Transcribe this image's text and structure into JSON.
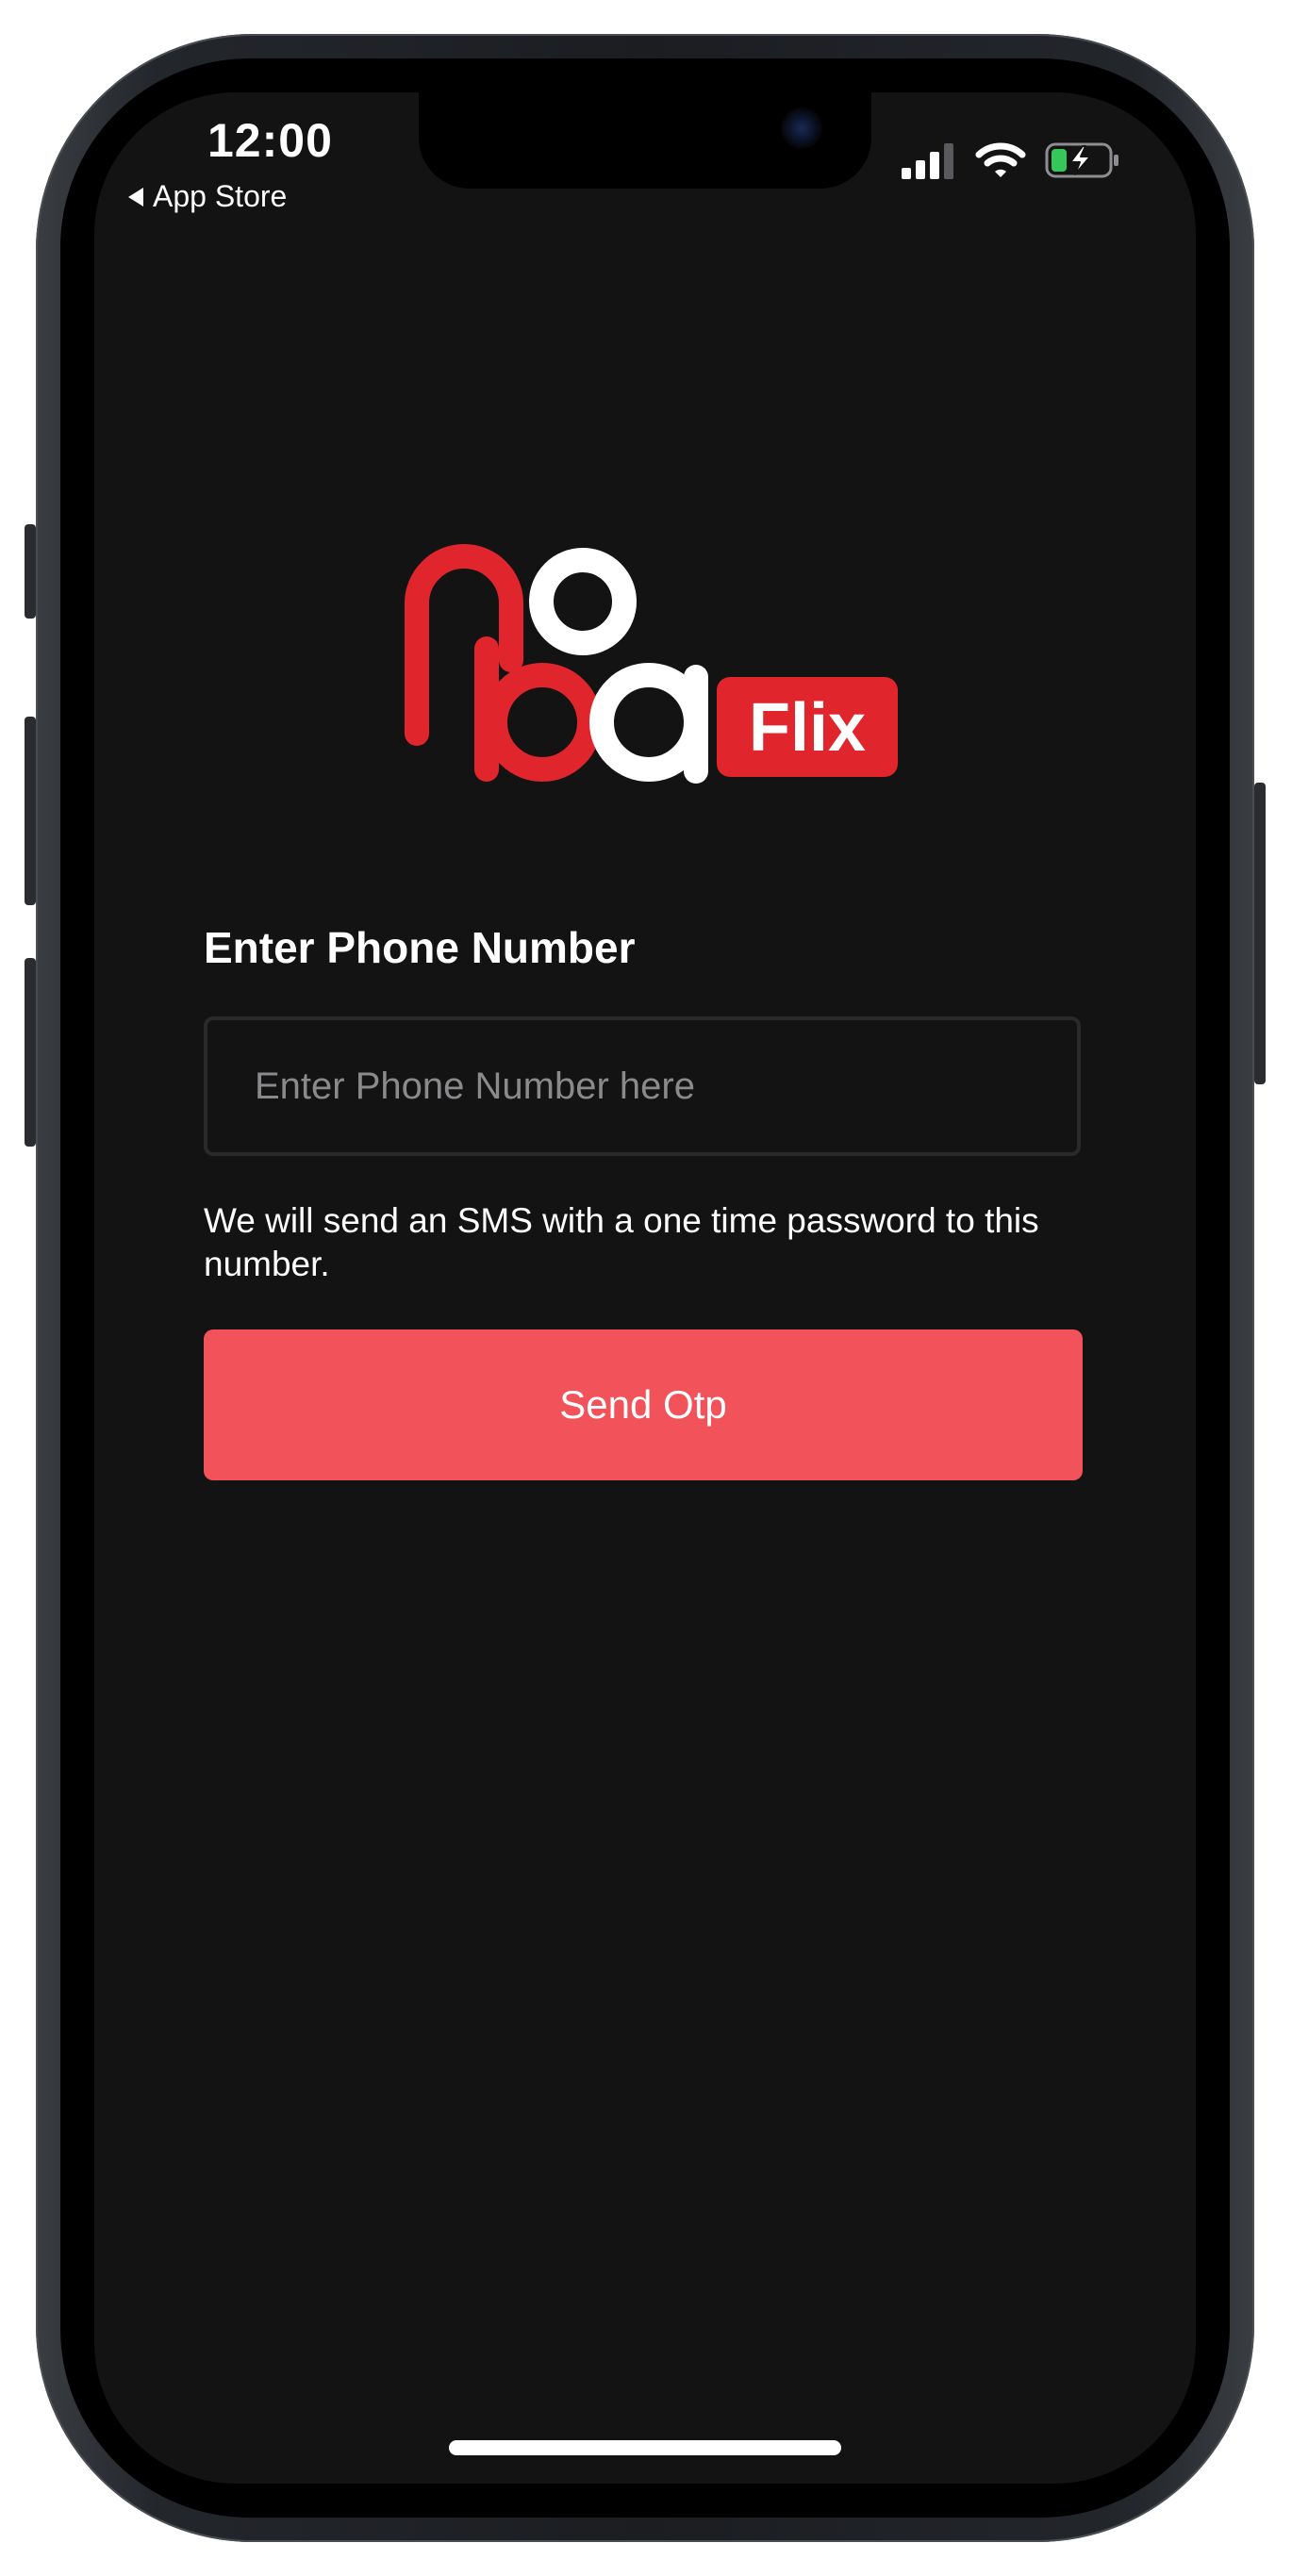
{
  "status_bar": {
    "time": "12:00",
    "back_label": "App Store"
  },
  "logo": {
    "wordmark_letters": [
      "n",
      "o",
      "b",
      "a"
    ],
    "badge_text": "Flix",
    "brand_red": "#e0262c",
    "brand_white": "#ffffff"
  },
  "form": {
    "title": "Enter Phone Number",
    "input_placeholder": "Enter Phone Number here",
    "input_value": "",
    "helper_text": "We will send an SMS with a one time password to this number.",
    "submit_label": "Send Otp",
    "accent_color": "#f2525a"
  },
  "icons": {
    "signal": "signal-icon",
    "wifi": "wifi-icon",
    "battery": "battery-charging-icon"
  }
}
